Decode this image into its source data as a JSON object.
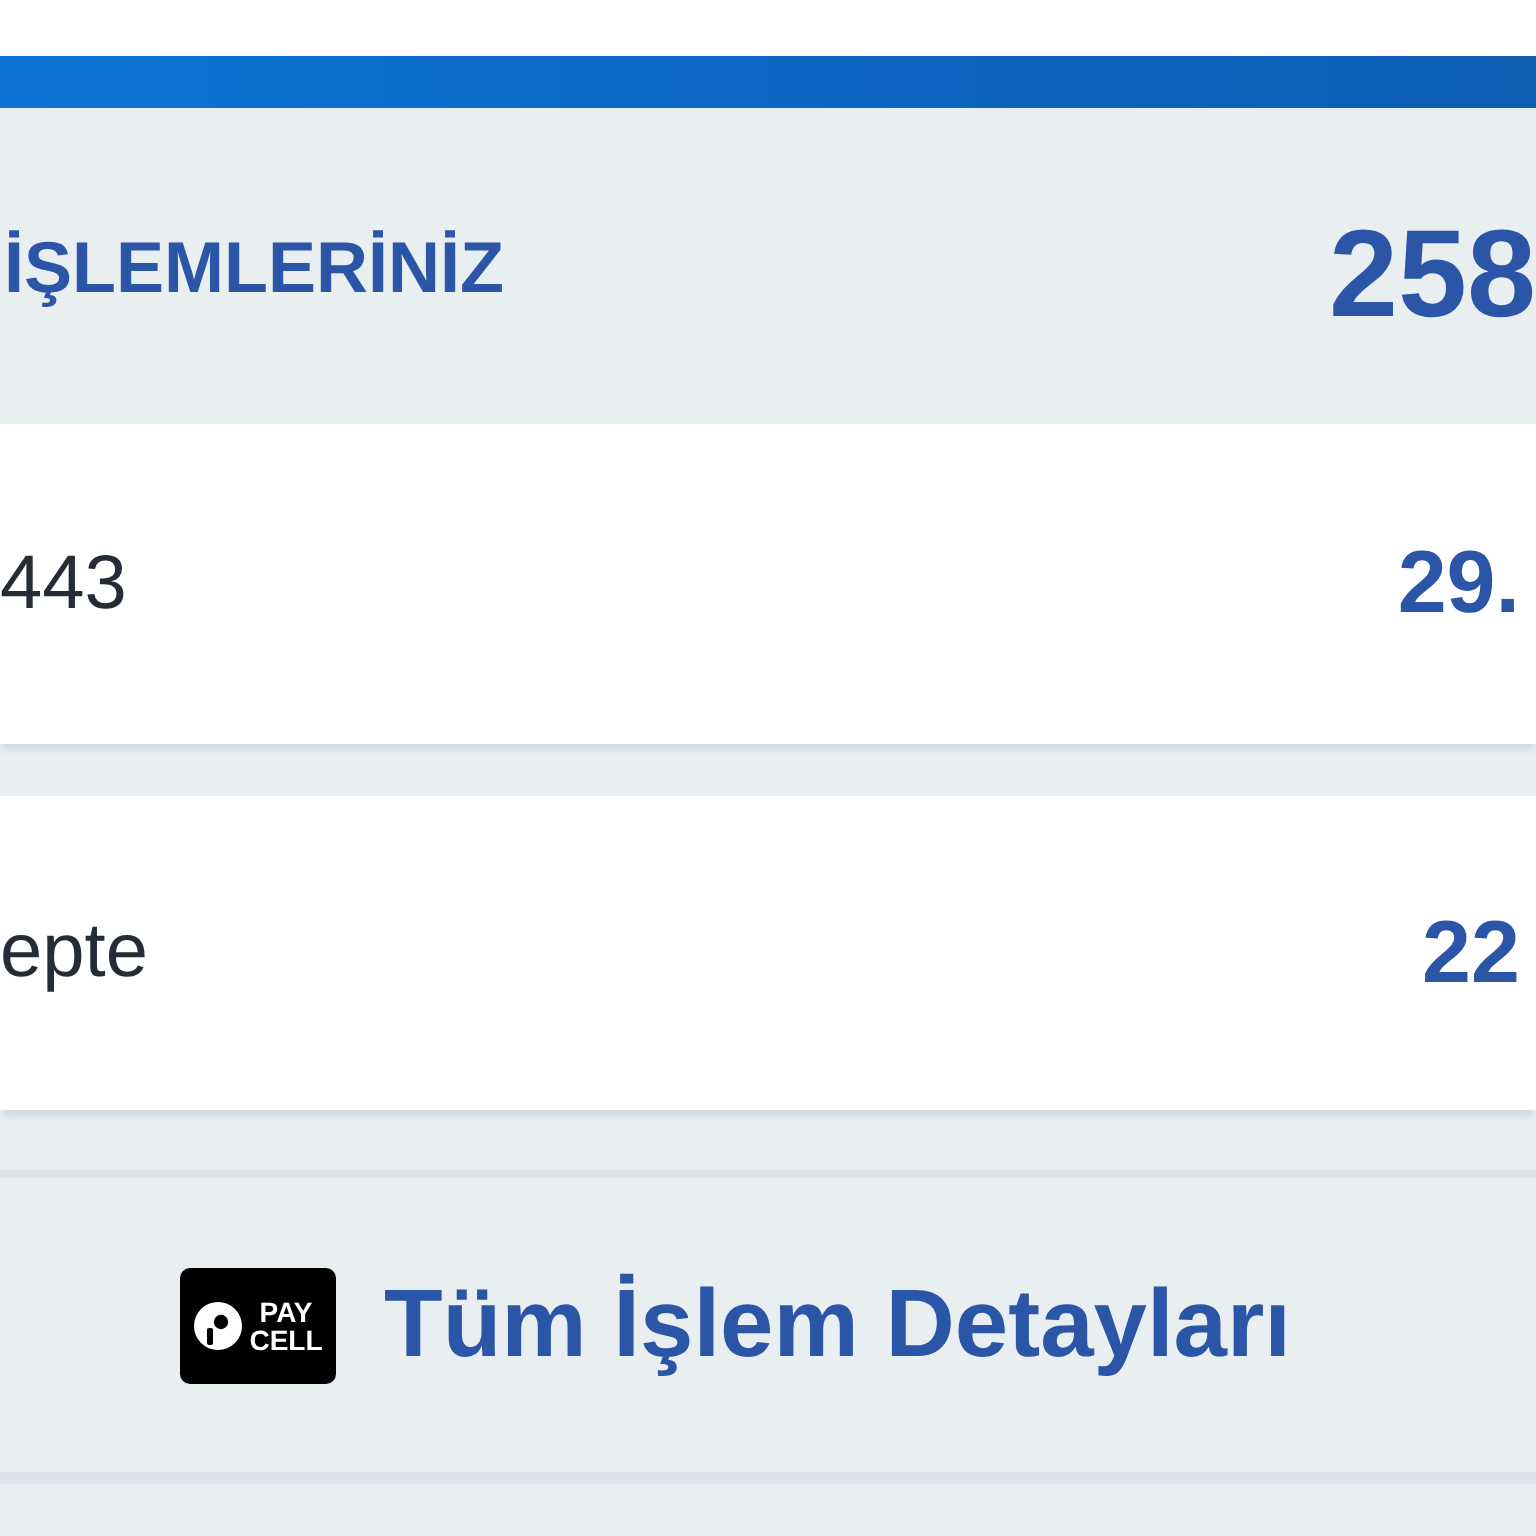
{
  "header": {
    "title": "İŞLEMLERİNİZ",
    "total": "258"
  },
  "transactions": [
    {
      "label": "443",
      "amount": "29."
    },
    {
      "label": "epte",
      "amount": "22"
    }
  ],
  "details_button": {
    "logo_text": [
      "PAY",
      "CELL"
    ],
    "label": "Tüm İşlem Detayları"
  }
}
